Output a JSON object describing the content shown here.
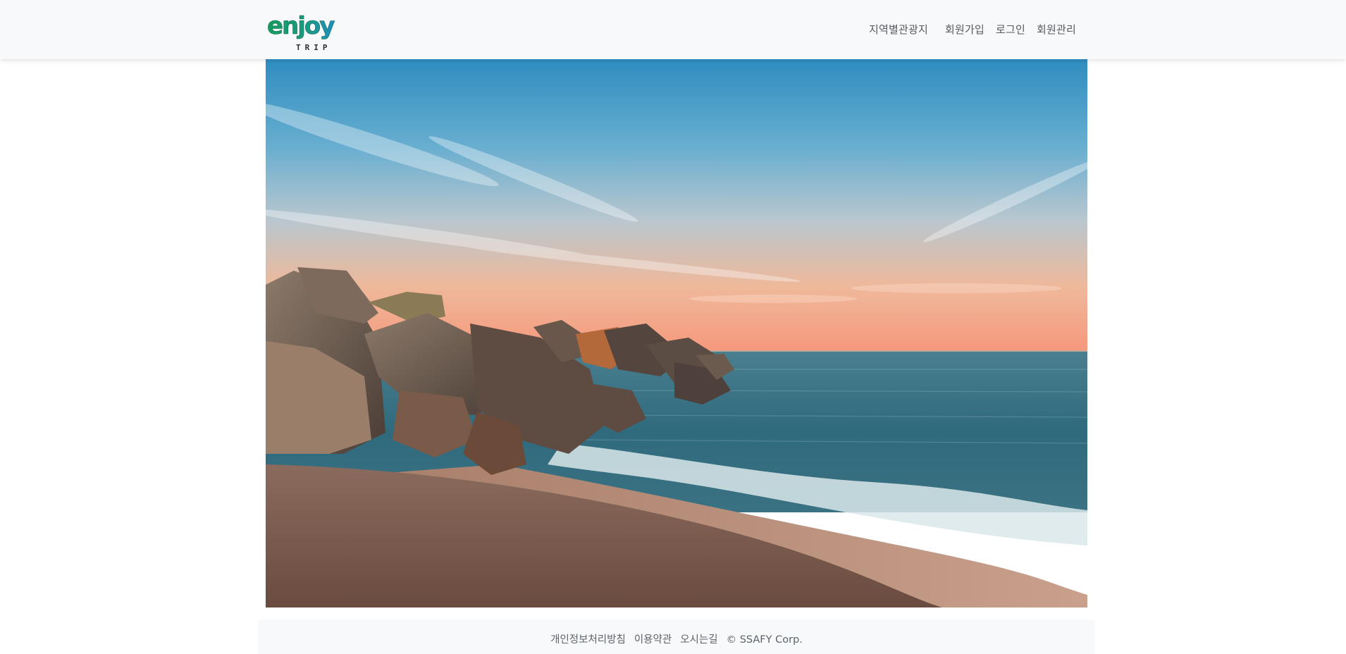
{
  "header": {
    "logo": {
      "main_text": "enjoy",
      "sub_text": "TRIP"
    },
    "nav": [
      {
        "label": "지역별관광지"
      },
      {
        "label": "회원가입"
      },
      {
        "label": "로그인"
      },
      {
        "label": "회원관리"
      }
    ]
  },
  "hero": {
    "image_subject": "sunset-beach-rocks"
  },
  "footer": {
    "links": [
      {
        "label": "개인정보처리방침"
      },
      {
        "label": "이용약관"
      },
      {
        "label": "오시는길"
      }
    ],
    "copyright": "© SSAFY Corp."
  },
  "colors": {
    "navbar_bg": "#f8f9fa",
    "logo_green": "#1a9a6b",
    "logo_blue": "#1f8fc4",
    "nav_text": "#555a60",
    "footer_text": "#5c636a"
  }
}
